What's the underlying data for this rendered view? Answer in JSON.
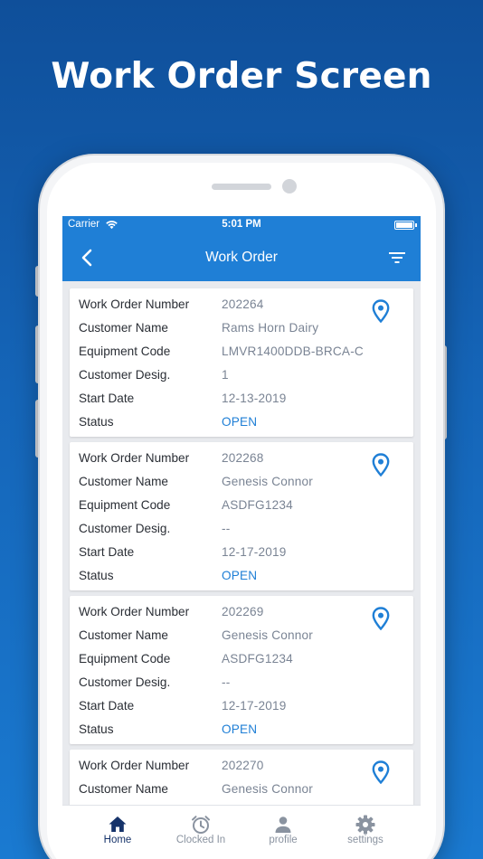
{
  "promo": {
    "title": "Work Order Screen"
  },
  "status_bar": {
    "carrier": "Carrier",
    "time": "5:01 PM"
  },
  "nav": {
    "title": "Work Order"
  },
  "labels": {
    "work_order_number": "Work Order Number",
    "customer_name": "Customer Name",
    "equipment_code": "Equipment Code",
    "customer_desig": "Customer Desig.",
    "start_date": "Start Date",
    "status": "Status"
  },
  "work_orders": [
    {
      "number": "202264",
      "customer": "Rams Horn Dairy",
      "equipment": "LMVR1400DDB-BRCA-C",
      "desig": "1",
      "start_date": "12-13-2019",
      "status": "OPEN"
    },
    {
      "number": "202268",
      "customer": "Genesis Connor",
      "equipment": "ASDFG1234",
      "desig": "--",
      "start_date": "12-17-2019",
      "status": "OPEN"
    },
    {
      "number": "202269",
      "customer": "Genesis Connor",
      "equipment": "ASDFG1234",
      "desig": "--",
      "start_date": "12-17-2019",
      "status": "OPEN"
    },
    {
      "number": "202270",
      "customer": "Genesis Connor"
    }
  ],
  "tabs": [
    {
      "label": "Home",
      "icon": "home-icon",
      "active": true
    },
    {
      "label": "Clocked In",
      "icon": "alarm-clock-icon"
    },
    {
      "label": "profile",
      "icon": "person-icon"
    },
    {
      "label": "settings",
      "icon": "gear-icon"
    }
  ],
  "colors": {
    "accent": "#1f7fd6",
    "active_tab": "#16336a",
    "inactive_tab": "#8a93a0",
    "value_text": "#7a8494"
  }
}
